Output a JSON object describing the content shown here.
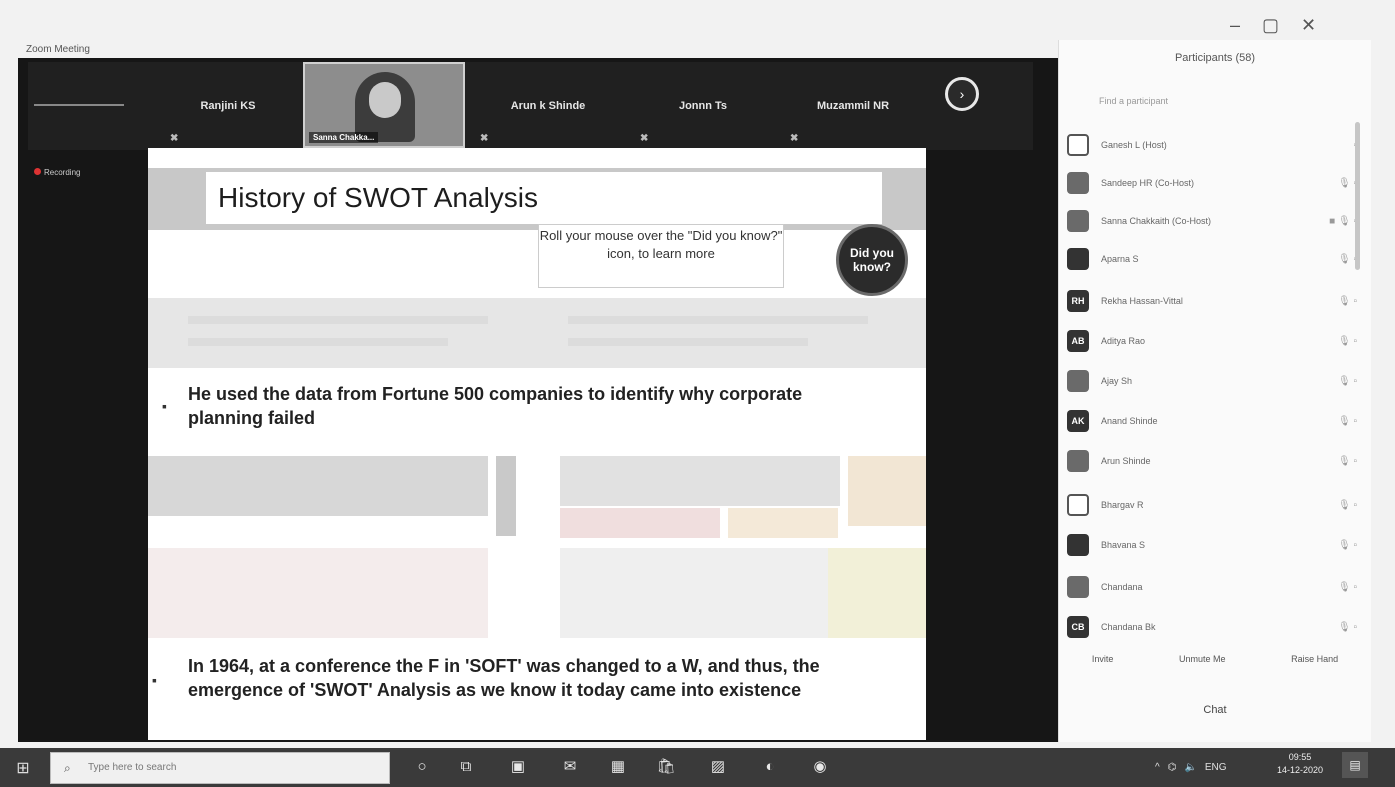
{
  "window": {
    "title": "Zoom Meeting",
    "controls": [
      "–",
      "▢",
      "✕"
    ]
  },
  "participants_strip": {
    "tiles": [
      {
        "name": "Ranjini KS"
      },
      {
        "name": "Sanna Chakka..."
      },
      {
        "name": "Arun k Shinde"
      },
      {
        "name": "Jonnn Ts"
      },
      {
        "name": "Muzammil NR"
      }
    ],
    "recording_label": "Recording",
    "more_icon": "chevron-right"
  },
  "slide": {
    "title": "History of SWOT Analysis",
    "hint": "Roll your mouse over the \"Did you know?\" icon, to learn more",
    "did_you_know": "Did you know?",
    "bullets": [
      "He used the data from Fortune 500 companies to identify why corporate planning failed",
      "In 1964, at a conference the F in 'SOFT' was changed to a W, and thus, the emergence of 'SWOT' Analysis as we know it today came into existence"
    ]
  },
  "panel": {
    "title": "Participants (58)",
    "search_placeholder": "Find a participant",
    "participants": [
      {
        "initials": "",
        "name": "Ganesh L (Host)",
        "style": "outline"
      },
      {
        "initials": "",
        "name": "Sandeep HR (Co-Host)",
        "style": "light"
      },
      {
        "initials": "",
        "name": "Sanna Chakkaith (Co-Host)",
        "style": "light"
      },
      {
        "initials": "",
        "name": "Aparna S",
        "style": "dark"
      },
      {
        "initials": "RH",
        "name": "Rekha Hassan-Vittal",
        "style": "dark"
      },
      {
        "initials": "AB",
        "name": "Aditya Rao",
        "style": "dark"
      },
      {
        "initials": "",
        "name": "Ajay Sh",
        "style": "light"
      },
      {
        "initials": "AK",
        "name": "Anand Shinde",
        "style": "dark"
      },
      {
        "initials": "",
        "name": "Arun Shinde",
        "style": "light"
      },
      {
        "initials": "",
        "name": "Bhargav R",
        "style": "outline"
      },
      {
        "initials": "",
        "name": "Bhavana S",
        "style": "dark"
      },
      {
        "initials": "",
        "name": "Chandana",
        "style": "light"
      },
      {
        "initials": "CB",
        "name": "Chandana Bk",
        "style": "dark"
      }
    ],
    "actions": [
      "Invite",
      "Unmute Me",
      "Raise Hand"
    ],
    "chat_label": "Chat"
  },
  "taskbar": {
    "search_placeholder": "Type here to search",
    "apps": [
      "cortana-icon",
      "task-view-icon",
      "zoom-icon",
      "mail-icon",
      "calendar-icon",
      "store-icon",
      "photos-icon",
      "edge-icon",
      "chrome-icon"
    ],
    "tray_language": "ENG",
    "time": "09:55",
    "date": "14-12-2020"
  }
}
